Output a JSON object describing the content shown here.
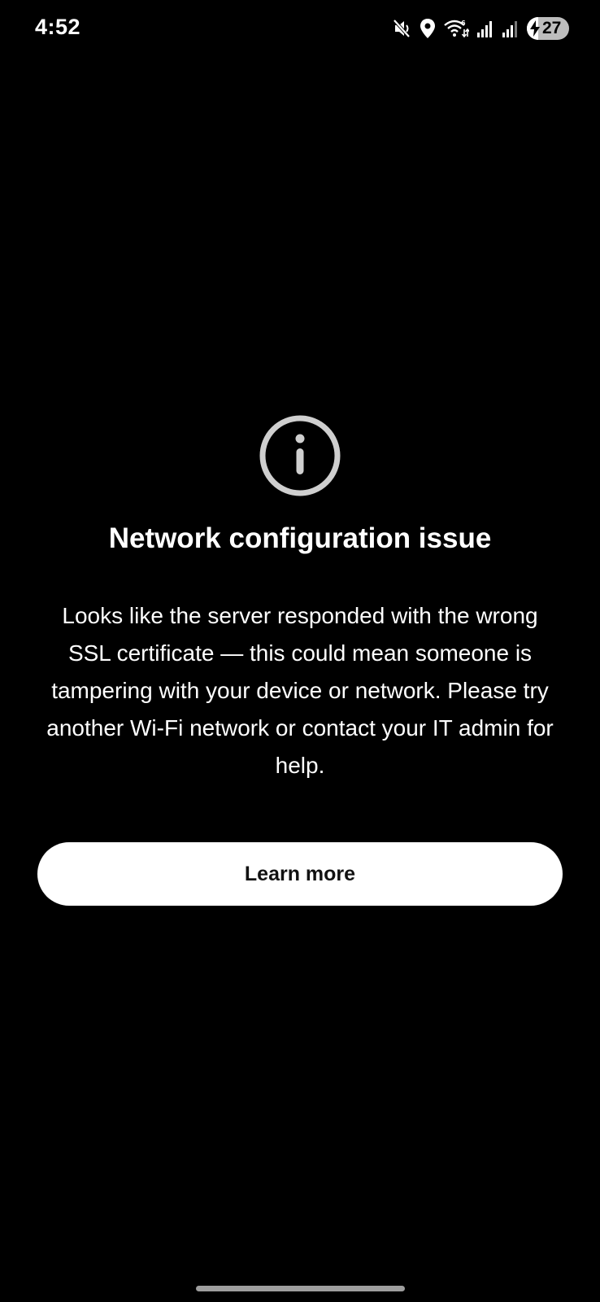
{
  "status_bar": {
    "time": "4:52",
    "battery_level": "27",
    "battery_fraction": 0.27,
    "icons": [
      "mute-vibrate-icon",
      "location-icon",
      "wifi-icon",
      "signal-icon",
      "signal-icon",
      "battery-charging-icon"
    ]
  },
  "dialog": {
    "icon": "info-icon",
    "title": "Network configuration issue",
    "message": "Looks like the server responded with the wrong SSL certificate — this could mean someone is tampering with your device or network. Please try another Wi-Fi network or contact your IT admin for help.",
    "button_label": "Learn more"
  },
  "colors": {
    "background": "#000000",
    "text": "#ffffff",
    "icon_stroke": "#cfcfcf",
    "button_bg": "#ffffff",
    "button_text": "#111111"
  }
}
